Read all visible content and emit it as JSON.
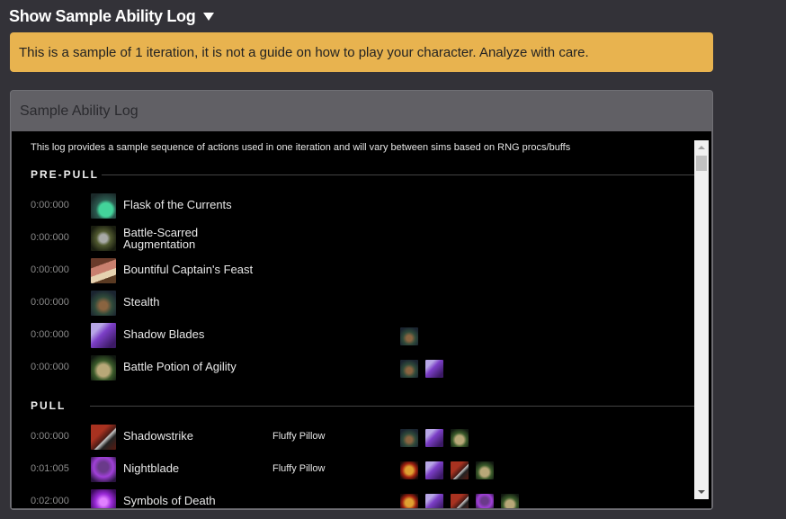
{
  "header": {
    "title": "Show Sample Ability Log",
    "caret_icon": "caret-down-icon"
  },
  "warning": {
    "text": "This is a sample of 1 iteration, it is not a guide on how to play your character. Analyze with care.",
    "color": "#e8b34f"
  },
  "panel": {
    "title": "Sample Ability Log",
    "intro": "This log provides a sample sequence of actions used in one iteration and will vary between sims based on RNG procs/buffs",
    "sections": [
      {
        "label": "PRE-PULL",
        "rows": [
          {
            "time": "0:00:000",
            "icon": "flask-of-the-currents-icon",
            "name": "Flask of the Currents",
            "target": "",
            "buffs": []
          },
          {
            "time": "0:00:000",
            "icon": "battle-scarred-augmentation-icon",
            "name": "Battle-Scarred Augmentation",
            "target": "",
            "buffs": []
          },
          {
            "time": "0:00:000",
            "icon": "bountiful-captains-feast-icon",
            "name": "Bountiful Captain's Feast",
            "target": "",
            "buffs": []
          },
          {
            "time": "0:00:000",
            "icon": "stealth-icon",
            "name": "Stealth",
            "target": "",
            "buffs": []
          },
          {
            "time": "0:00:000",
            "icon": "shadow-blades-icon",
            "name": "Shadow Blades",
            "target": "",
            "buffs": [
              "stealth-icon"
            ]
          },
          {
            "time": "0:00:000",
            "icon": "battle-potion-of-agility-icon",
            "name": "Battle Potion of Agility",
            "target": "",
            "buffs": [
              "stealth-icon",
              "shadow-blades-icon"
            ]
          }
        ]
      },
      {
        "label": "PULL",
        "rows": [
          {
            "time": "0:00:000",
            "icon": "shadowstrike-icon",
            "name": "Shadowstrike",
            "target": "Fluffy Pillow",
            "buffs": [
              "stealth-icon",
              "shadow-blades-icon",
              "battle-potion-of-agility-icon"
            ]
          },
          {
            "time": "0:01:005",
            "icon": "nightblade-icon",
            "name": "Nightblade",
            "target": "Fluffy Pillow",
            "buffs": [
              "bloodlust-icon",
              "shadow-blades-icon",
              "shadowstrike-icon",
              "battle-potion-of-agility-icon"
            ]
          },
          {
            "time": "0:02:000",
            "icon": "symbols-of-death-icon",
            "name": "Symbols of Death",
            "target": "",
            "buffs": [
              "bloodlust-icon",
              "shadow-blades-icon",
              "shadowstrike-icon",
              "nightblade-icon",
              "battle-potion-of-agility-icon"
            ]
          }
        ]
      }
    ]
  }
}
